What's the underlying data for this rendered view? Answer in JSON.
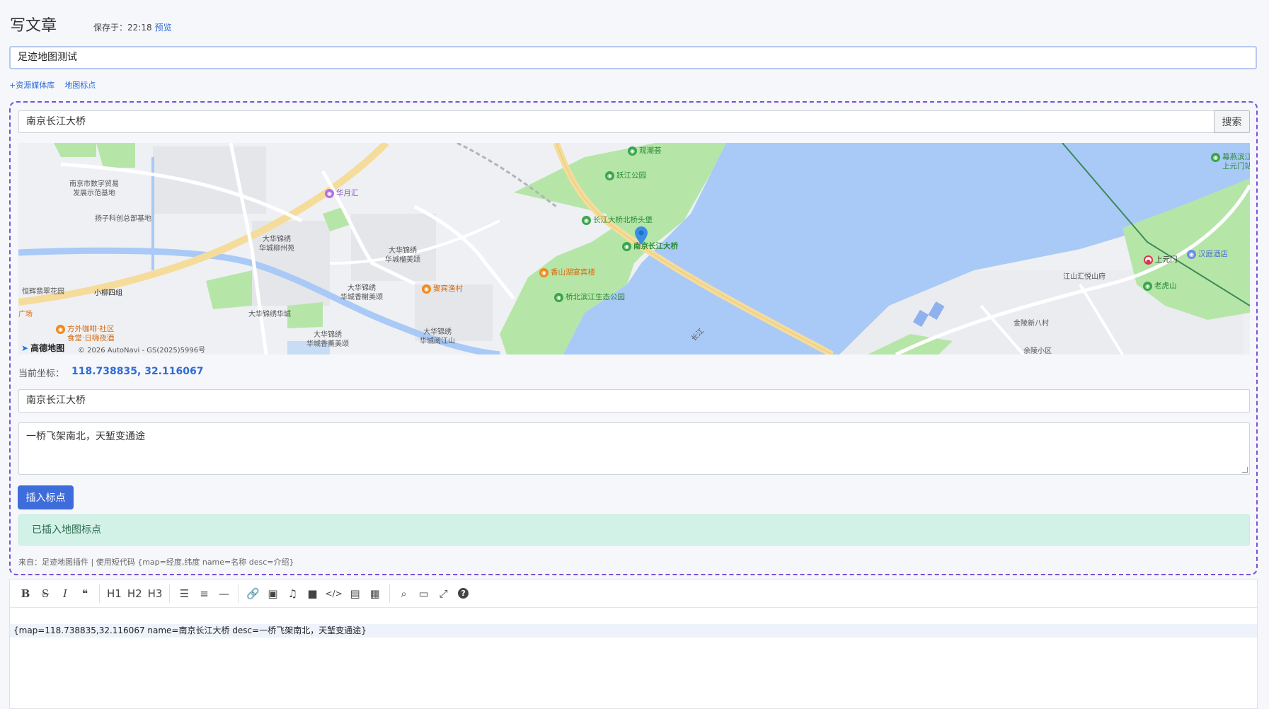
{
  "header": {
    "title": "写文章",
    "save_label": "保存于：22:18",
    "preview_label": "预览"
  },
  "post_title": "足迹地图测试",
  "links": {
    "media_library": "+资源媒体库",
    "map_marker": "地图标点"
  },
  "map_plugin": {
    "search_value": "南京长江大桥",
    "search_button": "搜索",
    "map": {
      "logo": "高德地图",
      "copyright": "© 2026 AutoNavi - GS(2025)5996号",
      "labels": [
        "南京市数字贸易\n发展示范基地",
        "扬子科创总部基地",
        "大华锦绣\n华城柳州苑",
        "大华锦绣\n华城榴美颂",
        "大华锦绣\n华城香榭美颂",
        "大华锦绣华城",
        "大华锦绣\n华城香薰美颂",
        "大华锦绣\n华城阅江山",
        "恒辉翡翠花园",
        "小柳四组",
        "广场",
        "江山汇悦山府",
        "金陵新八村",
        "长江",
        "余陵小区"
      ],
      "pois": [
        {
          "name": "观潮荟",
          "kind": "green"
        },
        {
          "name": "跃江公园",
          "kind": "green"
        },
        {
          "name": "华月汇",
          "kind": "purple"
        },
        {
          "name": "长江大桥北桥头堡",
          "kind": "green"
        },
        {
          "name": "南京长江大桥",
          "kind": "green"
        },
        {
          "name": "香山湖宴宾楼",
          "kind": "orange"
        },
        {
          "name": "聚宾渔村",
          "kind": "orange"
        },
        {
          "name": "桥北滨江生态公园",
          "kind": "green"
        },
        {
          "name": "方外咖啡·社区\n食堂·日嗨夜酒",
          "kind": "orange"
        },
        {
          "name": "幕燕滨江\n上元门站",
          "kind": "green"
        },
        {
          "name": "汉庭酒店",
          "kind": "blue"
        },
        {
          "name": "上元门",
          "kind": "red"
        },
        {
          "name": "老虎山",
          "kind": "green"
        }
      ]
    },
    "coord_label": "当前坐标：",
    "coord_value": "118.738835, 32.116067",
    "name_value": "南京长江大桥",
    "desc_value": "一桥飞架南北，天堑变通途",
    "insert_button": "插入标点",
    "alert_text": "已插入地图标点",
    "footnote": "来自：足迹地图插件 | 使用短代码 {map=经度,纬度 name=名称 desc=介绍}"
  },
  "editor": {
    "toolbar": {
      "bold": "B",
      "strike": "S",
      "italic": "I",
      "quote": "❝",
      "h1": "H1",
      "h2": "H2",
      "h3": "H3",
      "ul": "☰",
      "ol": "≡",
      "hr": "—",
      "link": "🔗",
      "image": "▣",
      "music": "♫",
      "video": "■",
      "code": "</>",
      "file": "▤",
      "table": "▦",
      "search": "⌕",
      "preview": "▭",
      "fullscreen": "⤢",
      "help": "?"
    },
    "content_line": "{map=118.738835,32.116067 name=南京长江大桥 desc=一桥飞架南北，天堑变通途}"
  },
  "colors": {
    "accent": "#3e6cdb",
    "plugin_border": "#7a52d6",
    "water": "#a9c9f7",
    "park": "#b5e6a8",
    "alert_bg": "#d3f2e7"
  }
}
